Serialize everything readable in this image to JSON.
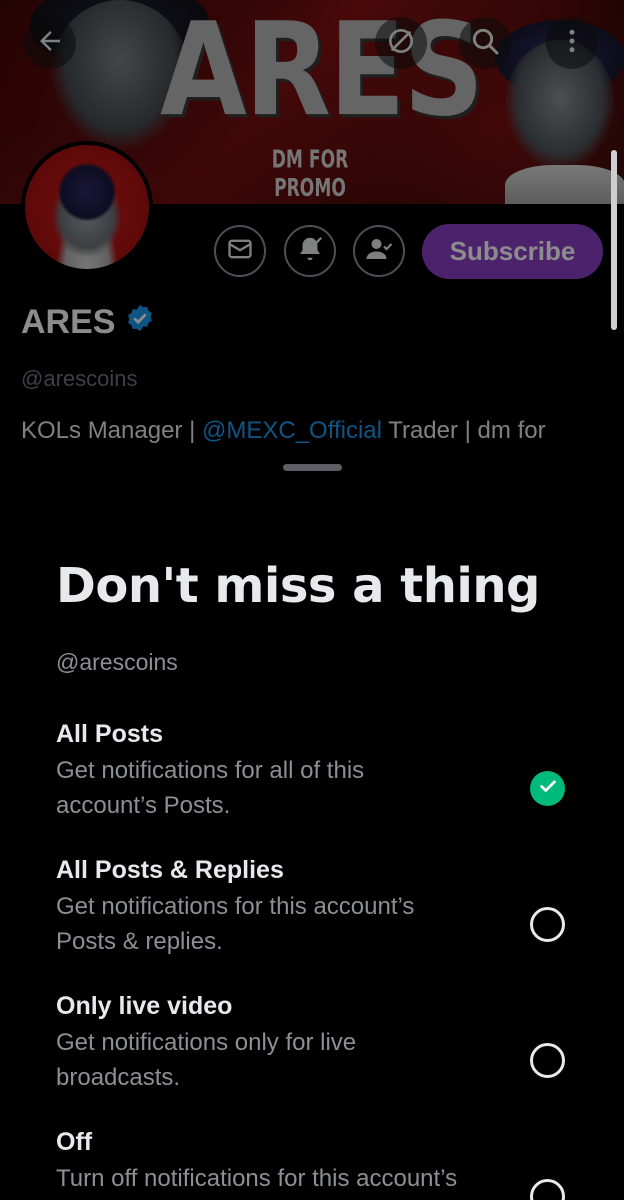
{
  "banner": {
    "title": "ARES",
    "tagline": "DM FOR PROMO"
  },
  "header": {
    "back_icon": "arrow-left-icon",
    "grok_icon": "grok-icon",
    "search_icon": "search-icon",
    "more_icon": "more-vertical-icon"
  },
  "profile": {
    "display_name": "ARES",
    "verified_icon": "verified-badge-icon",
    "handle": "@arescoins",
    "bio_prefix": "KOLs Manager | ",
    "bio_mention": "@MEXC_Official",
    "bio_suffix": " Trader | dm for",
    "bio_overflow_left": "ː",
    "bio_overflow_right": "ˎ",
    "actions": {
      "message_icon": "mail-icon",
      "notify_icon": "bell-check-icon",
      "following_icon": "person-check-icon",
      "subscribe_label": "Subscribe"
    },
    "colors": {
      "subscribe": "#8d3fc6",
      "mention": "#1d9bf0",
      "verified": "#1d9bf0"
    }
  },
  "sheet": {
    "title": "Don't miss a thing",
    "handle": "@arescoins",
    "options": [
      {
        "title": "All Posts",
        "desc_line1": "Get notifications for all of this",
        "desc_line2": "account’s Posts.",
        "selected": true
      },
      {
        "title": "All Posts & Replies",
        "desc_line1": "Get notifications for this account’s",
        "desc_line2": "Posts & replies.",
        "selected": false
      },
      {
        "title": "Only live video",
        "desc_line1": "Get notifications only for live",
        "desc_line2": "broadcasts.",
        "selected": false
      },
      {
        "title": "Off",
        "desc_line1": "Turn off notifications for this account’s",
        "desc_line2": "",
        "selected": false
      }
    ],
    "colors": {
      "selected": "#00ba7c"
    }
  }
}
